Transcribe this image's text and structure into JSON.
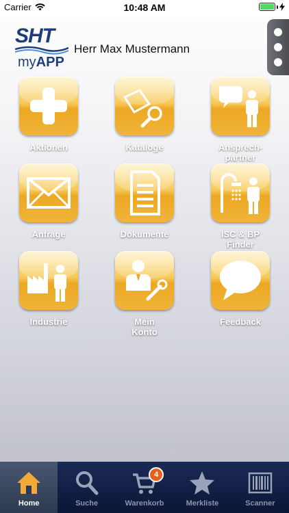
{
  "status_bar": {
    "carrier": "Carrier",
    "time": "10:48 AM"
  },
  "header": {
    "logo": {
      "brand": "SHT",
      "sub_prefix": "my",
      "sub_main": "APP"
    },
    "user_name": "Herr Max Mustermann"
  },
  "tiles": [
    {
      "label": "Aktionen",
      "icon": "plus-icon"
    },
    {
      "label": "Kataloge",
      "icon": "catalog-search-icon"
    },
    {
      "label": "Ansprech-\npartner",
      "icon": "contact-person-icon"
    },
    {
      "label": "Anfrage",
      "icon": "envelope-icon"
    },
    {
      "label": "Dokumente",
      "icon": "document-icon"
    },
    {
      "label": "ISC & BP\nFinder",
      "icon": "shower-person-icon"
    },
    {
      "label": "Industrie",
      "icon": "factory-person-icon"
    },
    {
      "label": "Mein\nKonto",
      "icon": "account-wrench-icon"
    },
    {
      "label": "Feedback",
      "icon": "speech-bubble-icon"
    }
  ],
  "tabbar": {
    "items": [
      {
        "label": "Home",
        "icon": "home-icon",
        "active": true
      },
      {
        "label": "Suche",
        "icon": "search-icon",
        "active": false
      },
      {
        "label": "Warenkorb",
        "icon": "cart-icon",
        "active": false,
        "badge": "4"
      },
      {
        "label": "Merkliste",
        "icon": "star-icon",
        "active": false
      },
      {
        "label": "Scanner",
        "icon": "barcode-icon",
        "active": false
      }
    ]
  },
  "colors": {
    "tile_orange": "#eda823",
    "brand_blue": "#1d3d7a",
    "tabbar_bg": "#1b2a56",
    "badge": "#e8601c"
  }
}
